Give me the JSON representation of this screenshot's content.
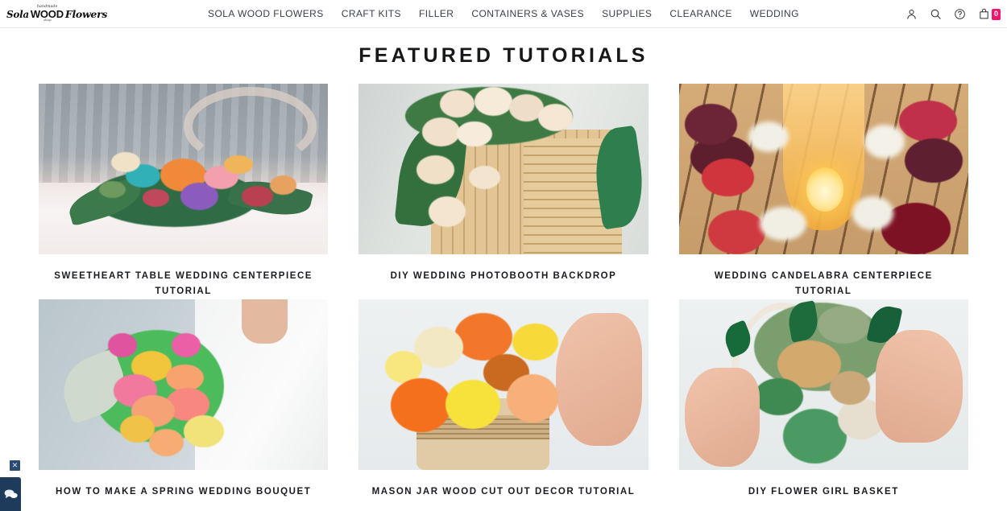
{
  "header": {
    "logo": {
      "tagline_top": "handmade",
      "word_script_1": "Sola",
      "word_bold": "WOOD",
      "word_script_2": "Flowers",
      "tagline_bottom": "shop"
    },
    "nav": [
      {
        "label": "SOLA WOOD FLOWERS",
        "name": "nav-sola-wood-flowers"
      },
      {
        "label": "CRAFT KITS",
        "name": "nav-craft-kits"
      },
      {
        "label": "FILLER",
        "name": "nav-filler"
      },
      {
        "label": "CONTAINERS & VASES",
        "name": "nav-containers-vases"
      },
      {
        "label": "SUPPLIES",
        "name": "nav-supplies"
      },
      {
        "label": "CLEARANCE",
        "name": "nav-clearance"
      },
      {
        "label": "WEDDING",
        "name": "nav-wedding"
      }
    ],
    "icons": {
      "account": "account-icon",
      "search": "search-icon",
      "help": "help-icon",
      "cart": "shopping-bag-icon"
    },
    "cart_count": "0",
    "cart_badge_color": "#f5156c"
  },
  "main": {
    "page_title": "FEATURED TUTORIALS",
    "tutorials": [
      {
        "title": "SWEETHEART TABLE WEDDING CENTERPIECE TUTORIAL",
        "scene": "s1"
      },
      {
        "title": "DIY WEDDING PHOTOBOOTH BACKDROP",
        "scene": "s2"
      },
      {
        "title": "WEDDING CANDELABRA CENTERPIECE TUTORIAL",
        "scene": "s3"
      },
      {
        "title": "HOW TO MAKE A SPRING WEDDING BOUQUET",
        "scene": "s4"
      },
      {
        "title": "MASON JAR WOOD CUT OUT DECOR TUTORIAL",
        "scene": "s5"
      },
      {
        "title": "DIY FLOWER GIRL BASKET",
        "scene": "s6"
      }
    ]
  },
  "chat": {
    "widget_label": "chat-bubbles-icon",
    "close_label": "✕",
    "color": "#1f3b5c"
  }
}
